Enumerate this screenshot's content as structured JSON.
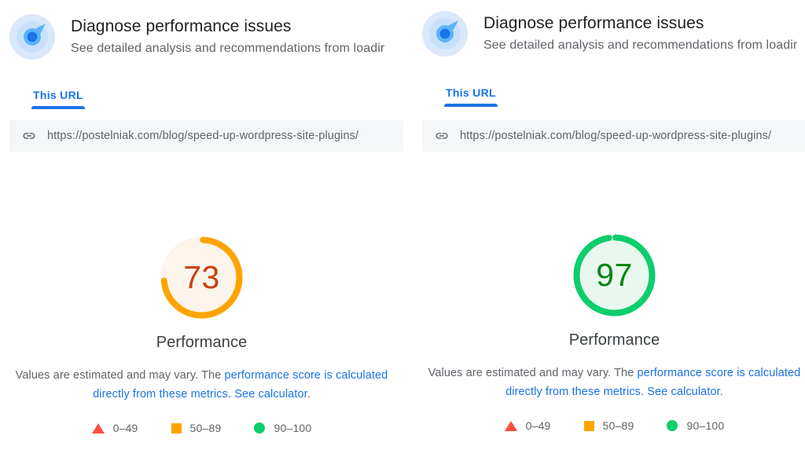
{
  "colors": {
    "link": "#1a73e8",
    "orange_ring": "#ffa400",
    "orange_fill": "#fdf4ec",
    "orange_text": "#c9420f",
    "green_ring": "#0cce6b",
    "green_fill": "#e9f8ef",
    "green_text": "#068512",
    "red": "#ff4e42",
    "icon_outer": "#dae8fc",
    "icon_mid": "#5ab4fb",
    "icon_dot": "#1a73e8"
  },
  "panels": [
    {
      "id": "left",
      "header": {
        "icon": "pagespeed-insights-icon",
        "title": "Diagnose performance issues",
        "subtitle": "See detailed analysis and recommendations from loadir"
      },
      "tabs": [
        {
          "label": "This URL",
          "active": true
        }
      ],
      "url_bar": {
        "icon": "link-icon",
        "url": "https://postelniak.com/blog/speed-up-wordpress-site-plugins/"
      },
      "gauge": {
        "score": "73",
        "label": "Performance",
        "category": "average"
      },
      "disclaimer": {
        "part1": "Values are estimated and may vary. The ",
        "link1": "performance score is calculated directly from these metrics",
        "part2": ". ",
        "link2": "See calculator",
        "part3": "."
      },
      "legend": [
        {
          "shape": "triangle",
          "range": "0–49"
        },
        {
          "shape": "square",
          "range": "50–89"
        },
        {
          "shape": "circle",
          "range": "90–100"
        }
      ]
    },
    {
      "id": "right",
      "header": {
        "icon": "pagespeed-insights-icon",
        "title": "Diagnose performance issues",
        "subtitle": "See detailed analysis and recommendations from loadir"
      },
      "tabs": [
        {
          "label": "This URL",
          "active": true
        }
      ],
      "url_bar": {
        "icon": "link-icon",
        "url": "https://postelniak.com/blog/speed-up-wordpress-site-plugins/"
      },
      "gauge": {
        "score": "97",
        "label": "Performance",
        "category": "good"
      },
      "disclaimer": {
        "part1": "Values are estimated and may vary. The ",
        "link1": "performance score is calculated directly from these metrics",
        "part2": ". ",
        "link2": "See calculator",
        "part3": "."
      },
      "legend": [
        {
          "shape": "triangle",
          "range": "0–49"
        },
        {
          "shape": "square",
          "range": "50–89"
        },
        {
          "shape": "circle",
          "range": "90–100"
        }
      ]
    }
  ],
  "chart_data": {
    "type": "gauge",
    "title": "Performance",
    "series": [
      {
        "name": "left-panel-performance",
        "value": 73,
        "max": 100,
        "color": "#ffa400",
        "category": "50–89"
      },
      {
        "name": "right-panel-performance",
        "value": 97,
        "max": 100,
        "color": "#0cce6b",
        "category": "90–100"
      }
    ],
    "legend_bands": [
      {
        "range": "0–49",
        "color": "#ff4e42",
        "marker": "triangle"
      },
      {
        "range": "50–89",
        "color": "#ffa400",
        "marker": "square"
      },
      {
        "range": "90–100",
        "color": "#0cce6b",
        "marker": "circle"
      }
    ],
    "legend_position": "bottom",
    "grid": false
  }
}
